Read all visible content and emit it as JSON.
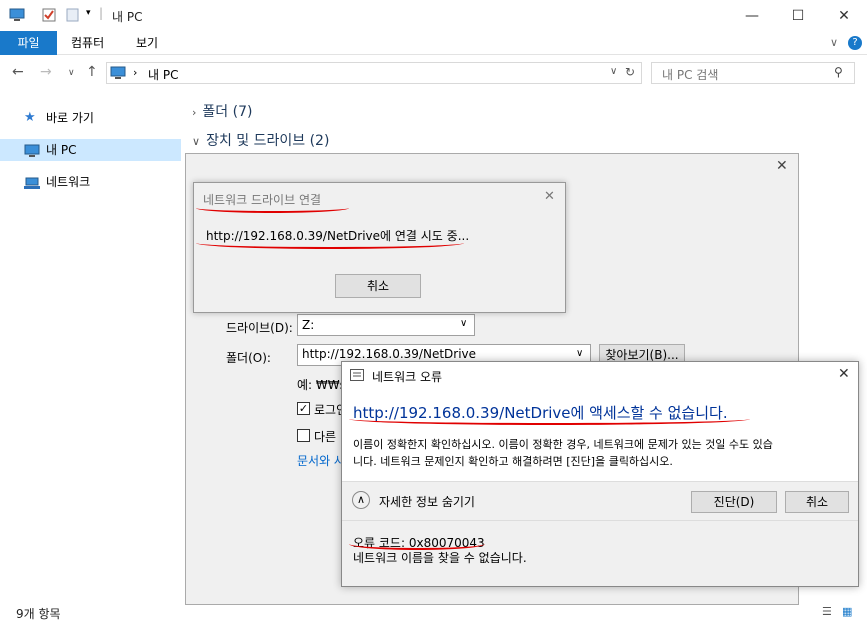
{
  "window": {
    "title": "내 PC",
    "minimize": "—",
    "maximize": "☐",
    "close": "✕"
  },
  "ribbon": {
    "tabs": [
      "파일",
      "컴퓨터",
      "보기"
    ],
    "collapse_icon": "∨",
    "help_icon": "?"
  },
  "address": {
    "path": "내 PC",
    "search_placeholder": "내 PC 검색"
  },
  "nav": {
    "items": [
      {
        "label": "바로 가기",
        "icon": "star-icon"
      },
      {
        "label": "내 PC",
        "icon": "computer-icon"
      },
      {
        "label": "네트워크",
        "icon": "network-icon"
      }
    ]
  },
  "content": {
    "groups": [
      {
        "label": "폴더 (7)"
      },
      {
        "label": "장치 및 드라이브 (2)"
      }
    ]
  },
  "status": {
    "items_count": "9개 항목"
  },
  "map_drive": {
    "drive_label": "드라이브(D):",
    "drive_value": "Z:",
    "folder_label": "폴더(O):",
    "folder_value": "http://192.168.0.39/NetDrive",
    "browse_button": "찾아보기(B)...",
    "example_text": "예: ₩₩se",
    "checkbox1_label": "로그인",
    "checkbox2_label": "다른",
    "link_text": "문서와 사"
  },
  "connecting": {
    "title": "네트워크 드라이브 연결",
    "message": "http://192.168.0.39/NetDrive에 연결 시도 중...",
    "cancel_button": "취소"
  },
  "error": {
    "title": "네트워크 오류",
    "heading": "http://192.168.0.39/NetDrive에 액세스할 수 없습니다.",
    "body_line1": "이름이 정확한지 확인하십시오. 이름이 정확한 경우, 네트워크에 문제가 있는 것일 수도 있습",
    "body_line2": "니다. 네트워크 문제인지 확인하고 해결하려면 [진단]을 클릭하십시오.",
    "details_toggle": "자세한 정보 숨기기",
    "diagnose_button": "진단(D)",
    "cancel_button": "취소",
    "code_line": "오류 코드: 0x80070043",
    "detail_line": "네트워크 이름을 찾을 수 없습니다."
  }
}
